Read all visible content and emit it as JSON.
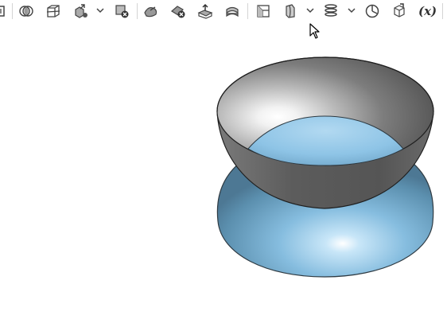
{
  "toolbar": {
    "items": [
      {
        "name": "partial-body-icon"
      },
      {
        "name": "combine-icon"
      },
      {
        "name": "split-body-icon"
      },
      {
        "name": "move-copy-icon"
      },
      {
        "name": "delete-body-icon"
      },
      {
        "name": "deform-face-icon"
      },
      {
        "name": "delete-face-icon"
      },
      {
        "name": "move-face-icon"
      },
      {
        "name": "thicken-icon"
      },
      {
        "name": "plane-icon"
      },
      {
        "name": "split-line-icon"
      },
      {
        "name": "helix-icon"
      },
      {
        "name": "curvature-icon"
      },
      {
        "name": "equations-icon"
      }
    ],
    "equations_label": "(x)"
  },
  "viewport": {
    "upper_shell_color": "#5a5a5a",
    "lower_shell_color": "#8cbfe0"
  }
}
